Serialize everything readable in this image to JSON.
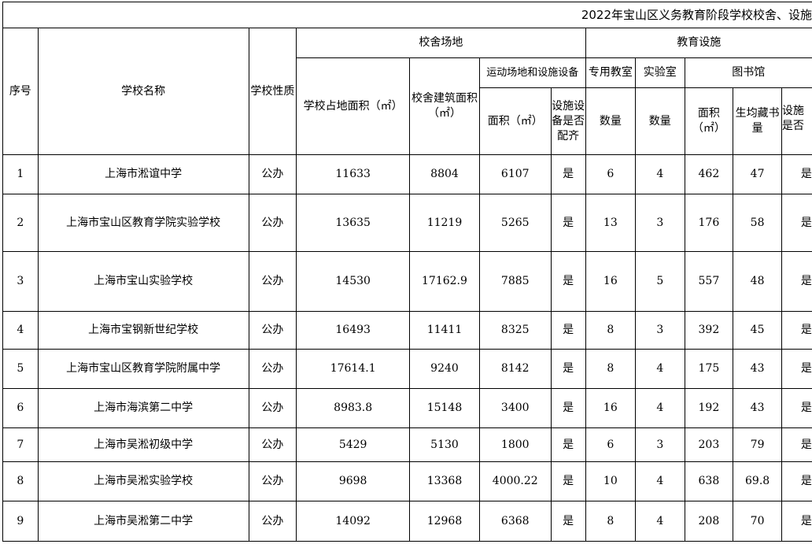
{
  "title": "2022年宝山区义务教育阶段学校校舍、设施",
  "headers": {
    "seq": "序号",
    "school_name": "学校名称",
    "school_type": "学校性质",
    "campus": "校舍场地",
    "land_area": "学校占地面积（㎡）",
    "building_area": "校舍建筑面积（㎡）",
    "sports": "运动场地和设施设备",
    "sports_area": "面积（㎡）",
    "sports_equipped": "设施设备是否配齐",
    "edu_facilities": "教育设施",
    "special_room": "专用教室",
    "special_count": "数量",
    "lab": "实验室",
    "lab_count": "数量",
    "library": "图书馆",
    "lib_area": "面积（㎡）",
    "lib_books": "生均藏书量",
    "lib_equipped": "设施是否"
  },
  "rows": [
    {
      "seq": "1",
      "name": "上海市淞谊中学",
      "type": "公办",
      "land": "11633",
      "building": "8804",
      "sports_area": "6107",
      "equipped": "是",
      "special": "6",
      "lab": "4",
      "lib_area": "462",
      "books": "47",
      "lib_eq": "是"
    },
    {
      "seq": "2",
      "name": "上海市宝山区教育学院实验学校",
      "type": "公办",
      "land": "13635",
      "building": "11219",
      "sports_area": "5265",
      "equipped": "是",
      "special": "13",
      "lab": "3",
      "lib_area": "176",
      "books": "58",
      "lib_eq": "是"
    },
    {
      "seq": "3",
      "name": "上海市宝山实验学校",
      "type": "公办",
      "land": "14530",
      "building": "17162.9",
      "sports_area": "7885",
      "equipped": "是",
      "special": "16",
      "lab": "5",
      "lib_area": "557",
      "books": "48",
      "lib_eq": "是"
    },
    {
      "seq": "4",
      "name": "上海市宝钢新世纪学校",
      "type": "公办",
      "land": "16493",
      "building": "11411",
      "sports_area": "8325",
      "equipped": "是",
      "special": "8",
      "lab": "3",
      "lib_area": "392",
      "books": "45",
      "lib_eq": "是"
    },
    {
      "seq": "5",
      "name": "上海市宝山区教育学院附属中学",
      "type": "公办",
      "land": "17614.1",
      "building": "9240",
      "sports_area": "8142",
      "equipped": "是",
      "special": "8",
      "lab": "4",
      "lib_area": "175",
      "books": "43",
      "lib_eq": "是"
    },
    {
      "seq": "6",
      "name": "上海市海滨第二中学",
      "type": "公办",
      "land": "8983.8",
      "building": "15148",
      "sports_area": "3400",
      "equipped": "是",
      "special": "16",
      "lab": "4",
      "lib_area": "192",
      "books": "43",
      "lib_eq": "是"
    },
    {
      "seq": "7",
      "name": "上海市吴淞初级中学",
      "type": "公办",
      "land": "5429",
      "building": "5130",
      "sports_area": "1800",
      "equipped": "是",
      "special": "6",
      "lab": "3",
      "lib_area": "203",
      "books": "79",
      "lib_eq": "是"
    },
    {
      "seq": "8",
      "name": "上海市吴淞实验学校",
      "type": "公办",
      "land": "9698",
      "building": "13368",
      "sports_area": "4000.22",
      "equipped": "是",
      "special": "10",
      "lab": "4",
      "lib_area": "638",
      "books": "69.8",
      "lib_eq": "是"
    },
    {
      "seq": "9",
      "name": "上海市吴淞第二中学",
      "type": "公办",
      "land": "14092",
      "building": "12968",
      "sports_area": "6368",
      "equipped": "是",
      "special": "8",
      "lab": "4",
      "lib_area": "208",
      "books": "70",
      "lib_eq": "是"
    }
  ]
}
